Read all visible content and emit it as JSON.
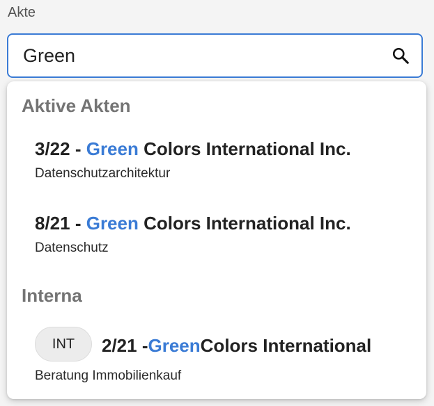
{
  "field": {
    "label": "Akte",
    "value": "Green"
  },
  "icons": {
    "search": "search-icon"
  },
  "colors": {
    "accent": "#3a7bd5",
    "group_header": "#747474"
  },
  "groups": [
    {
      "header": "Aktive Akten",
      "options": [
        {
          "prefix": "3/22 - ",
          "match": "Green",
          "suffix": " Colors International Inc.",
          "subtitle": "Datenschutzarchitektur"
        },
        {
          "prefix": "8/21 - ",
          "match": "Green",
          "suffix": " Colors International Inc.",
          "subtitle": "Datenschutz"
        }
      ]
    },
    {
      "header": "Interna",
      "options": [
        {
          "badge": "INT",
          "prefix": "2/21 -",
          "match": "Green",
          "suffix": "Colors International",
          "subtitle": "Beratung Immobilienkauf"
        }
      ]
    }
  ]
}
